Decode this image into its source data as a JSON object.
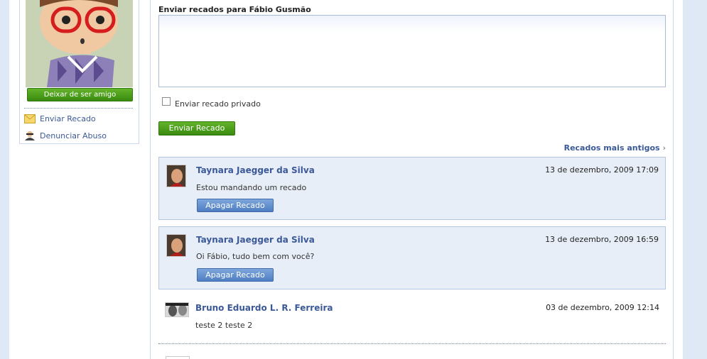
{
  "sidebar": {
    "unfriend_label": "Deixar de ser amigo",
    "links": [
      {
        "label": "Enviar Recado",
        "icon": "envelope-icon"
      },
      {
        "label": "Denunciar Abuso",
        "icon": "bandit-icon"
      }
    ]
  },
  "compose": {
    "heading": "Enviar recados para Fábio Gusmão",
    "textarea_value": "",
    "private_label": "Enviar recado privado",
    "private_checked": false,
    "send_label": "Enviar Recado"
  },
  "older_link": "Recados mais antigos",
  "scraps": [
    {
      "name": "Taynara Jaegger da Silva",
      "date": "13 de dezembro, 2009 17:09",
      "message": "Estou mandando um recado",
      "delete_label": "Apagar Recado"
    },
    {
      "name": "Taynara Jaegger da Silva",
      "date": "13 de dezembro, 2009 16:59",
      "message": "Oi Fábio, tudo bem com você?",
      "delete_label": "Apagar Recado"
    },
    {
      "name": "Bruno Eduardo L. R. Ferreira",
      "date": "03 de dezembro, 2009 12:14",
      "message": "teste 2 teste 2"
    }
  ],
  "colors": {
    "link": "#3b5998",
    "green_button": "#4a9a1c",
    "blue_button": "#5a87c8",
    "highlight_bg": "#e8eef8",
    "page_bg": "#dfe8f5"
  }
}
